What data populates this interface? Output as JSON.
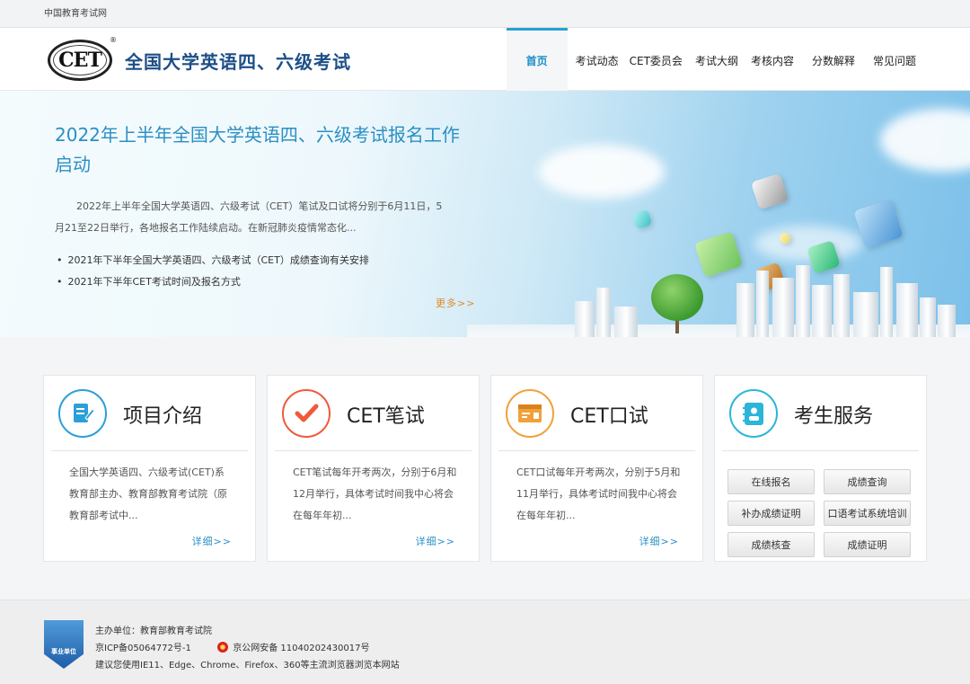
{
  "topbar": {
    "site_link": "中国教育考试网"
  },
  "header": {
    "logo_text": "CET",
    "logo_reg": "®",
    "site_title": "全国大学英语四、六级考试",
    "nav": [
      {
        "label": "首页",
        "active": true
      },
      {
        "label": "考试动态"
      },
      {
        "label": "CET委员会"
      },
      {
        "label": "考试大纲"
      },
      {
        "label": "考核内容"
      },
      {
        "label": "分数解释"
      },
      {
        "label": "常见问题"
      }
    ]
  },
  "banner": {
    "title": "2022年上半年全国大学英语四、六级考试报名工作启动",
    "description": "2022年上半年全国大学英语四、六级考试（CET）笔试及口试将分别于6月11日，5月21至22日举行，各地报名工作陆续启动。在新冠肺炎疫情常态化...",
    "links": [
      "2021年下半年全国大学英语四、六级考试（CET）成绩查询有关安排",
      "2021年下半年CET考试时间及报名方式"
    ],
    "more": "更多>>"
  },
  "cards": [
    {
      "title": "项目介绍",
      "icon": "document-edit-icon",
      "text": "全国大学英语四、六级考试(CET)系教育部主办、教育部教育考试院（原教育部考试中...",
      "more": "详细>>"
    },
    {
      "title": "CET笔试",
      "icon": "checkmark-icon",
      "text": "CET笔试每年开考两次，分别于6月和12月举行，具体考试时间我中心将会在每年年初...",
      "more": "详细>>"
    },
    {
      "title": "CET口试",
      "icon": "id-card-icon",
      "text": "CET口试每年开考两次，分别于5月和11月举行，具体考试时间我中心将会在每年年初...",
      "more": "详细>>"
    },
    {
      "title": "考生服务",
      "icon": "contact-book-icon",
      "buttons": [
        "在线报名",
        "成绩查询",
        "补办成绩证明",
        "口语考试系统培训",
        "成绩核查",
        "成绩证明"
      ]
    }
  ],
  "footer": {
    "badge_label": "事业单位",
    "sponsor": "主办单位：教育部教育考试院",
    "icp": "京ICP备05064772号-1",
    "police": "京公网安备 11040202430017号",
    "browser_tip": "建议您使用IE11、Edge、Chrome、Firefox、360等主流浏览器浏览本网站"
  },
  "colors": {
    "accent": "#2a8fc4",
    "title_blue": "#1d4f86",
    "more_orange": "#e08a2a",
    "card1_icon": "#2b9fd8",
    "card2_icon": "#f05a3a",
    "card3_icon": "#f0a13a",
    "card4_icon": "#2bb5d8"
  }
}
